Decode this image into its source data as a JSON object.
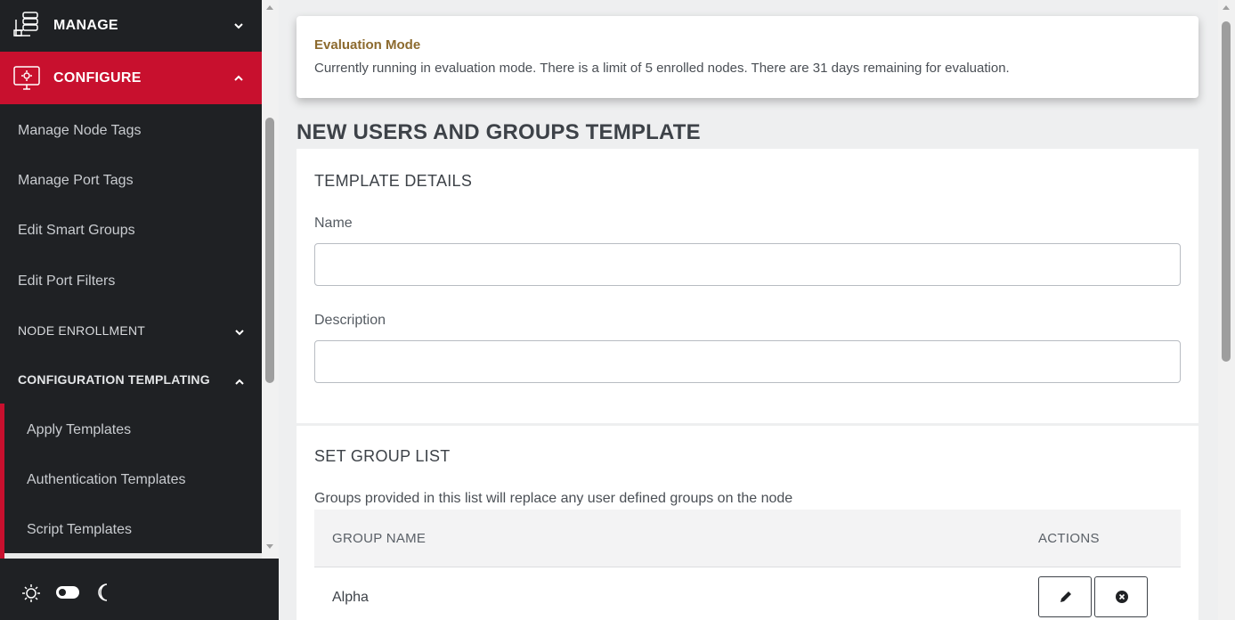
{
  "sidebar": {
    "manage_label": "MANAGE",
    "configure_label": "CONFIGURE",
    "items": [
      {
        "label": "Manage Node Tags"
      },
      {
        "label": "Manage Port Tags"
      },
      {
        "label": "Edit Smart Groups"
      },
      {
        "label": "Edit Port Filters"
      }
    ],
    "node_enrollment_label": "NODE ENROLLMENT",
    "config_templating_label": "CONFIGURATION TEMPLATING",
    "templating_items": [
      {
        "label": "Apply Templates"
      },
      {
        "label": "Authentication Templates"
      },
      {
        "label": "Script Templates"
      }
    ]
  },
  "eval": {
    "title": "Evaluation Mode",
    "text": "Currently running in evaluation mode. There is a limit of 5 enrolled nodes. There are 31 days remaining for evaluation."
  },
  "page": {
    "title": "NEW USERS AND GROUPS TEMPLATE"
  },
  "template_details": {
    "heading": "TEMPLATE DETAILS",
    "name_label": "Name",
    "name_value": "",
    "description_label": "Description",
    "description_value": ""
  },
  "group_list": {
    "heading": "SET GROUP LIST",
    "description": "Groups provided in this list will replace any user defined groups on the node",
    "columns": [
      "GROUP NAME",
      "ACTIONS"
    ],
    "rows": [
      {
        "name": "Alpha"
      }
    ]
  },
  "colors": {
    "accent": "#c8102e",
    "sidebar_bg": "#1f2124",
    "eval_title": "#8c6a2e"
  }
}
